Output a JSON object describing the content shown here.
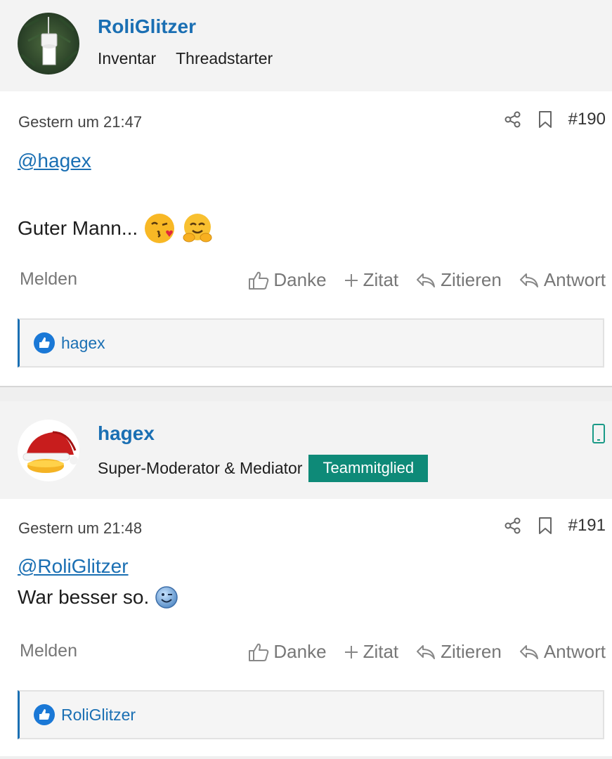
{
  "posts": [
    {
      "author": {
        "name": "RoliGlitzer",
        "roles": [
          "Inventar",
          "Threadstarter"
        ],
        "avatar_icon": "toilet-paper-holder-icon"
      },
      "timestamp": "Gestern um 21:47",
      "post_number": "#190",
      "mention": "@hagex",
      "text": "Guter Mann...",
      "emojis": [
        "kissing-face-with-heart-emoji",
        "hugging-face-emoji"
      ],
      "report_label": "Melden",
      "actions": {
        "thanks": "Danke",
        "quote_add": "Zitat",
        "quote": "Zitieren",
        "reply": "Antwort"
      },
      "reactions": {
        "icon": "thumbs-up-icon",
        "users": "hagex"
      }
    },
    {
      "author": {
        "name": "hagex",
        "roles": [
          "Super-Moderator & Mediator"
        ],
        "badge": "Teammitglied",
        "avatar_icon": "santa-hat-avatar-icon",
        "device_icon": "mobile-phone-icon"
      },
      "timestamp": "Gestern um 21:48",
      "post_number": "#191",
      "mention": "@RoliGlitzer",
      "text": "War besser so.",
      "emojis": [
        "winking-smiley-emoji"
      ],
      "report_label": "Melden",
      "actions": {
        "thanks": "Danke",
        "quote_add": "Zitat",
        "quote": "Zitieren",
        "reply": "Antwort"
      },
      "reactions": {
        "icon": "thumbs-up-icon",
        "users": "RoliGlitzer"
      }
    }
  ],
  "colors": {
    "link": "#1a6fb3",
    "badge_bg": "#0e8a78",
    "muted": "#777777",
    "author_bar_bg": "#f3f3f3"
  }
}
